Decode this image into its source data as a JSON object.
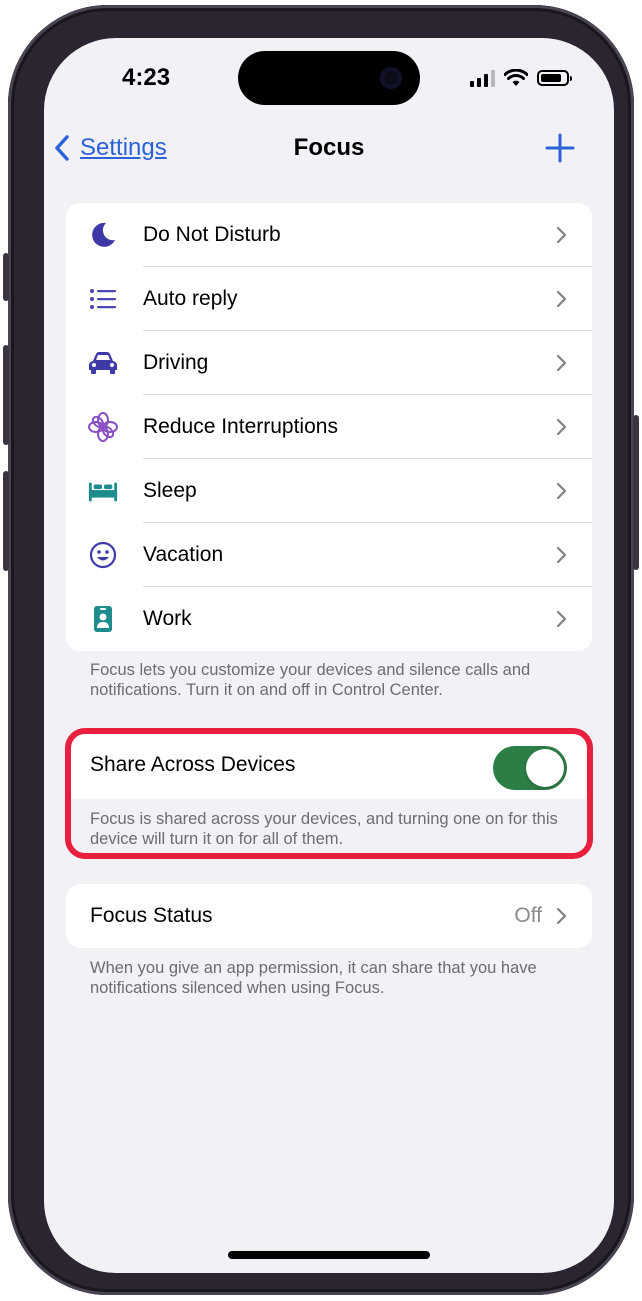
{
  "status_bar": {
    "time": "4:23"
  },
  "nav": {
    "back_label": "Settings",
    "title": "Focus"
  },
  "focus_modes": [
    {
      "label": "Do Not Disturb",
      "icon": "moon-icon",
      "color": "#3d3aa8"
    },
    {
      "label": "Auto reply",
      "icon": "list-icon",
      "color": "#4a47b5"
    },
    {
      "label": "Driving",
      "icon": "car-icon",
      "color": "#3d3aa8"
    },
    {
      "label": "Reduce Interruptions",
      "icon": "flower-icon",
      "color": "#8a4fc4"
    },
    {
      "label": "Sleep",
      "icon": "bed-icon",
      "color": "#1e8c8c"
    },
    {
      "label": "Vacation",
      "icon": "smiley-icon",
      "color": "#3d3aa8"
    },
    {
      "label": "Work",
      "icon": "badge-icon",
      "color": "#1e8c8c"
    }
  ],
  "modes_footnote": "Focus lets you customize your devices and silence calls and notifications. Turn it on and off in Control Center.",
  "share": {
    "label": "Share Across Devices",
    "enabled": true,
    "footnote": "Focus is shared across your devices, and turning one on for this device will turn it on for all of them."
  },
  "focus_status": {
    "label": "Focus Status",
    "value": "Off",
    "footnote": "When you give an app permission, it can share that you have notifications silenced when using Focus."
  },
  "colors": {
    "accent": "#2b62d9",
    "toggle_on": "#2d7d46",
    "highlight": "#e8203e"
  }
}
